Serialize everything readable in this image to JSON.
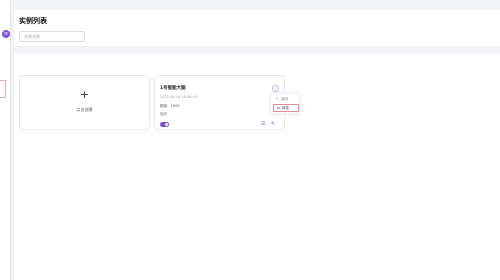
{
  "header": {
    "title": "实例列表",
    "search_placeholder": "实例名称"
  },
  "add_card": {
    "plus": "+",
    "label": "点击创建"
  },
  "instance": {
    "name": "1号智能大脑",
    "time": "2025-06-16 15:56:43",
    "quota_label": "额度：",
    "quota_value": "1900",
    "desc": "描述",
    "enabled": true
  },
  "dropdown": {
    "items": [
      {
        "icon": "edit-icon",
        "label": "编辑"
      },
      {
        "icon": "transfer-icon",
        "label": "转发"
      }
    ]
  },
  "colors": {
    "accent": "#7b4fe0",
    "highlight_border": "#e58a98"
  }
}
